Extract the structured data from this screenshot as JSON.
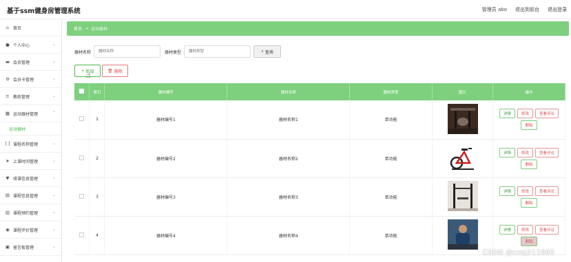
{
  "app": {
    "title": "基于ssm健身房管理系统"
  },
  "topbar": {
    "user": "管理员 abo",
    "to_front": "退出到前台",
    "logout": "退出登录"
  },
  "sidebar": {
    "items": [
      {
        "label": "首页",
        "icon": "home-icon",
        "chev": ""
      },
      {
        "label": "个人中心",
        "icon": "user-icon",
        "chev": "⌄"
      },
      {
        "label": "会员管理",
        "icon": "card-icon",
        "chev": "⌄"
      },
      {
        "label": "会员卡管理",
        "icon": "gear-icon",
        "chev": "⌄"
      },
      {
        "label": "教练管理",
        "icon": "list-icon",
        "chev": "⌄"
      },
      {
        "label": "运动器材管理",
        "icon": "grid-icon",
        "chev": "⌃"
      }
    ],
    "sub_item": "运动器材",
    "items_after": [
      {
        "label": "课程名称管理",
        "icon": "bracket-icon",
        "chev": "⌄"
      },
      {
        "label": "上课时间管理",
        "icon": "send-icon",
        "chev": "⌄"
      },
      {
        "label": "排课信息管理",
        "icon": "filter-icon",
        "chev": "⌄"
      },
      {
        "label": "课程信息管理",
        "icon": "doc-icon",
        "chev": "⌄"
      },
      {
        "label": "课程预约管理",
        "icon": "chart-icon",
        "chev": "⌄"
      },
      {
        "label": "课程评价管理",
        "icon": "chat-icon",
        "chev": "⌄"
      },
      {
        "label": "留言板管理",
        "icon": "board-icon",
        "chev": "⌄"
      }
    ]
  },
  "breadcrumb": {
    "home": "首页",
    "sep": "→",
    "current": "运动器材"
  },
  "search": {
    "label1": "器材名称",
    "placeholder1": "器材名称",
    "label2": "器材类型",
    "placeholder2": "器材类型",
    "button": "查询"
  },
  "actions": {
    "add": "新增",
    "delete": "删除"
  },
  "table": {
    "headers": [
      "索引",
      "器材编号",
      "器材名称",
      "器材类型",
      "图片",
      "操作"
    ],
    "rows": [
      {
        "index": "1",
        "code": "器材编号1",
        "name": "器材名称1",
        "type": "单功能",
        "photo": "gym-machine"
      },
      {
        "index": "2",
        "code": "器材编号2",
        "name": "器材名称2",
        "type": "单功能",
        "photo": "spin-bike"
      },
      {
        "index": "3",
        "code": "器材编号3",
        "name": "器材名称3",
        "type": "单功能",
        "photo": "rack"
      },
      {
        "index": "4",
        "code": "器材编号4",
        "name": "器材名称4",
        "type": "单功能",
        "photo": "trainer"
      }
    ],
    "ops": {
      "detail": "详情",
      "edit": "修改",
      "review": "查看评论",
      "remove": "删除"
    }
  },
  "watermark": "CSDN @cxsj211985",
  "colors": {
    "accent": "#7ed07e",
    "accent_dark": "#4cb84c",
    "danger": "#d9534f"
  }
}
